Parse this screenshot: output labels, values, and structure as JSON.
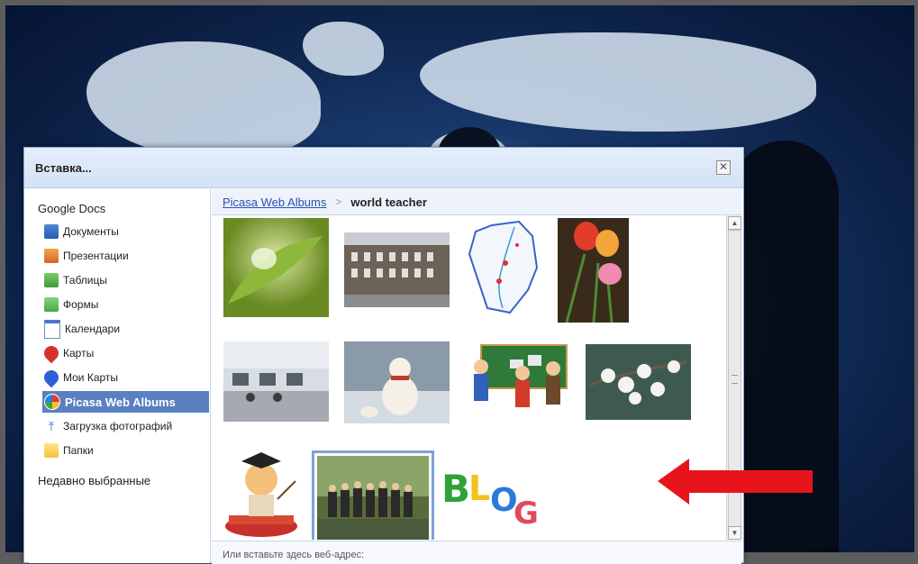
{
  "dialog": {
    "title": "Вставка...",
    "close_glyph": "✕"
  },
  "sidebar": {
    "group_label": "Google Docs",
    "items": [
      {
        "label": "Документы",
        "icon": "documents-icon"
      },
      {
        "label": "Презентации",
        "icon": "presentations-icon"
      },
      {
        "label": "Таблицы",
        "icon": "spreadsheets-icon"
      },
      {
        "label": "Формы",
        "icon": "forms-icon"
      },
      {
        "label": "Календари",
        "icon": "calendar-icon"
      },
      {
        "label": "Карты",
        "icon": "map-pin-icon"
      },
      {
        "label": "Мои Карты",
        "icon": "my-maps-pin-icon"
      },
      {
        "label": "Picasa Web Albums",
        "icon": "picasa-icon",
        "active": true
      },
      {
        "label": "Загрузка фотографий",
        "icon": "upload-icon"
      },
      {
        "label": "Папки",
        "icon": "folder-icon"
      }
    ],
    "recent_label": "Недавно выбранные"
  },
  "breadcrumb": {
    "link": "Picasa Web Albums",
    "separator": ">",
    "current": "world teacher"
  },
  "photos": [
    {
      "name": "leaf-water-drop",
      "selected": false
    },
    {
      "name": "building-street",
      "selected": false
    },
    {
      "name": "region-map",
      "selected": false
    },
    {
      "name": "tulips",
      "selected": false
    },
    {
      "name": "computer-classroom",
      "selected": false
    },
    {
      "name": "snowman-dog",
      "selected": false
    },
    {
      "name": "cartoon-teachers-puzzle",
      "selected": false
    },
    {
      "name": "white-blossom-branch",
      "selected": false
    },
    {
      "name": "cartoon-graduate-books",
      "selected": false
    },
    {
      "name": "group-photo-forest",
      "selected": true
    },
    {
      "name": "blog-3d-letters",
      "selected": false
    }
  ],
  "url_prompt": "Или вставьте здесь веб-адрес:",
  "colors": {
    "active_nav": "#5b80c2",
    "link": "#2a4fb0",
    "arrow": "#e8141c"
  }
}
